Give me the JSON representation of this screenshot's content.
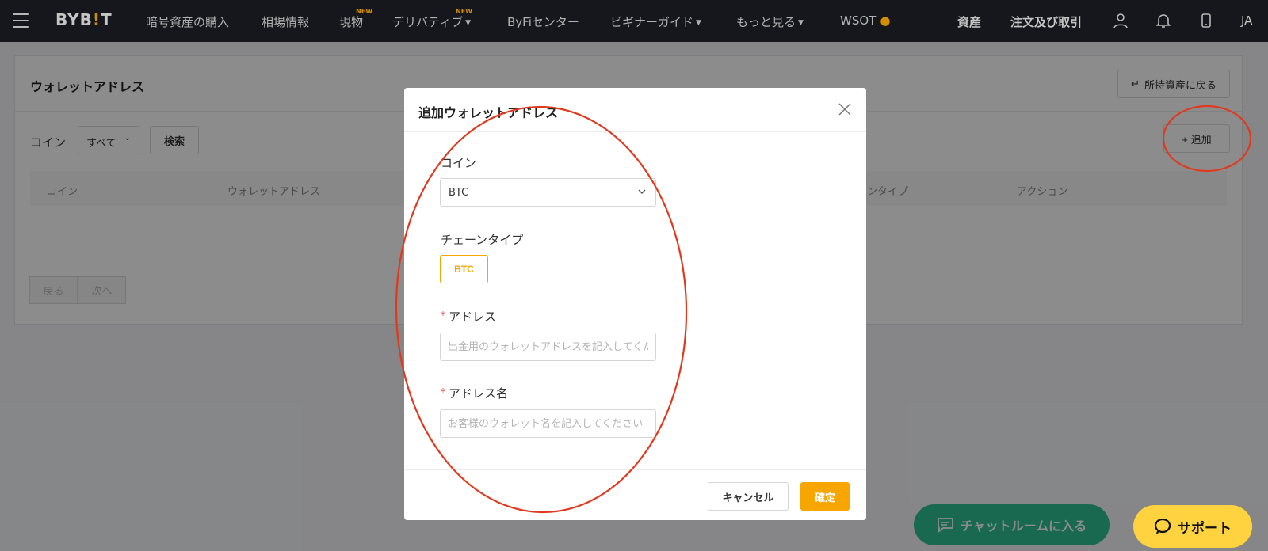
{
  "nav": {
    "logo_prefix": "BYB",
    "logo_bar": "!",
    "logo_suffix": "T",
    "items": [
      {
        "label": "暗号資産の購入"
      },
      {
        "label": "相場情報"
      },
      {
        "label": "現物",
        "badge": "NEW"
      },
      {
        "label": "デリバティブ",
        "badge": "NEW"
      },
      {
        "label": "ByFiセンター"
      },
      {
        "label": "ビギナーガイド"
      },
      {
        "label": "もっと見る"
      },
      {
        "label": "WSOT"
      }
    ],
    "assets": "資産",
    "orders": "注文及び取引",
    "lang": "JA"
  },
  "page": {
    "title": "ウォレットアドレス",
    "back_label": "所持資産に戻る",
    "filter_label": "コイン",
    "filter_value": "すべて",
    "search_label": "検索",
    "add_label": "追加",
    "columns": [
      "コイン",
      "ウォレットアドレス",
      "ンタイプ",
      "アクション"
    ],
    "prev_label": "戻る",
    "next_label": "次へ"
  },
  "modal": {
    "title": "追加ウォレットアドレス",
    "coin_label": "コイン",
    "coin_value": "BTC",
    "chain_label": "チェーンタイプ",
    "chain_value": "BTC",
    "address_label": "アドレス",
    "address_placeholder": "出金用のウォレットアドレスを記入してください",
    "name_label": "アドレス名",
    "name_placeholder": "お客様のウォレット名を記入してください",
    "cancel_label": "キャンセル",
    "confirm_label": "確定"
  },
  "floating": {
    "chat_label": "チャットルームに入る",
    "support_label": "サポート"
  },
  "colors": {
    "accent": "#f7a600",
    "nav_bg": "#1a1c21",
    "annotation": "#e03a1e",
    "chat": "#2fbf93",
    "support": "#ffd23f"
  }
}
